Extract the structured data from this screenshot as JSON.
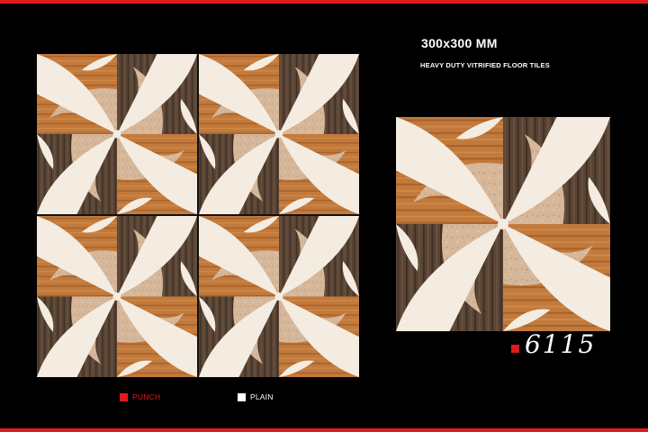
{
  "header": {
    "size_label": "300x300 MM",
    "product_type": "HEAVY DUTY VITRIFIED FLOOR TILES"
  },
  "product": {
    "code": "6115"
  },
  "legend": {
    "punch_label": "PUNCH",
    "plain_label": "PLAIN"
  },
  "colors": {
    "background": "#000000",
    "accent_red": "#e01b1b",
    "tile_orange_wood": "#c27a3c",
    "tile_dark_wood": "#5a4535",
    "tile_beige_stone": "#d6b79a",
    "tile_cream": "#f4ece1"
  },
  "tile_layout": {
    "grid_rows": 2,
    "grid_columns": 2
  }
}
